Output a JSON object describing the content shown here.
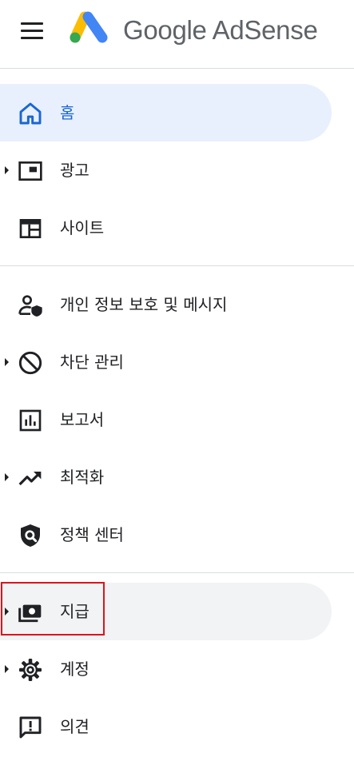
{
  "header": {
    "brand": "Google AdSense",
    "menu_icon": "hamburger-menu-icon",
    "logo_icon": "adsense-logo-icon"
  },
  "colors": {
    "active_text": "#1967d2",
    "active_bg": "#e8f0fe",
    "hover_bg": "#f1f3f4",
    "text": "#202124",
    "divider": "#dadce0",
    "highlight": "#e0121c"
  },
  "nav": {
    "home": {
      "label": "홈",
      "icon": "home-icon"
    },
    "ads": {
      "label": "광고",
      "icon": "ad-unit-icon"
    },
    "sites": {
      "label": "사이트",
      "icon": "web-layout-icon"
    },
    "privacy": {
      "label": "개인 정보 보호 및 메시지",
      "icon": "privacy-person-shield-icon"
    },
    "blocking": {
      "label": "차단 관리",
      "icon": "block-icon"
    },
    "reports": {
      "label": "보고서",
      "icon": "bar-chart-icon"
    },
    "optimization": {
      "label": "최적화",
      "icon": "trending-up-icon"
    },
    "policy": {
      "label": "정책 센터",
      "icon": "policy-shield-icon"
    },
    "payments": {
      "label": "지급",
      "icon": "payments-icon"
    },
    "account": {
      "label": "계정",
      "icon": "gear-icon"
    },
    "feedback": {
      "label": "의견",
      "icon": "feedback-icon"
    }
  }
}
